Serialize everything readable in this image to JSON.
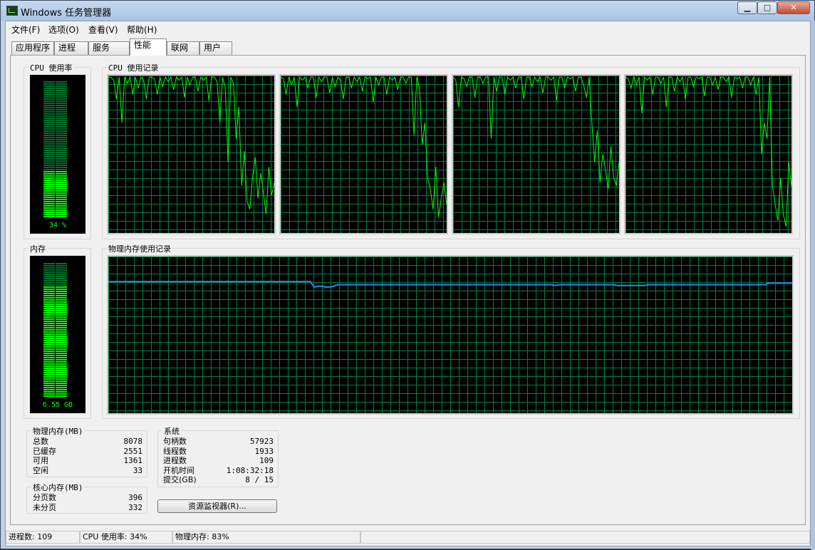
{
  "window": {
    "title": "Windows 任务管理器",
    "controls": {
      "minimize": "▁",
      "maximize": "□",
      "close": "✕"
    }
  },
  "menu": [
    {
      "label": "文件(F)"
    },
    {
      "label": "选项(O)"
    },
    {
      "label": "查看(V)"
    },
    {
      "label": "帮助(H)"
    }
  ],
  "tabs": [
    {
      "label": "应用程序",
      "active": false
    },
    {
      "label": "进程",
      "active": false
    },
    {
      "label": "服务",
      "active": false
    },
    {
      "label": "性能",
      "active": true
    },
    {
      "label": "联网",
      "active": false
    },
    {
      "label": "用户",
      "active": false
    }
  ],
  "performance": {
    "cpu_usage": {
      "title": "CPU 使用率",
      "value_text": "34 %",
      "percent": 34
    },
    "cpu_history": {
      "title": "CPU 使用记录",
      "cores": [
        [
          99,
          99,
          97,
          85,
          99,
          70,
          99,
          95,
          99,
          88,
          99,
          92,
          99,
          97,
          85,
          99,
          99,
          98,
          88,
          99,
          93,
          99,
          96,
          99,
          91,
          99,
          97,
          99,
          86,
          99,
          94,
          99,
          99,
          90,
          99,
          97,
          99,
          84,
          99,
          99,
          96,
          70,
          99,
          92,
          45,
          99,
          95,
          60,
          80,
          30,
          52,
          20,
          15,
          35,
          48,
          22,
          38,
          26,
          12,
          42,
          24,
          32
        ],
        [
          99,
          98,
          88,
          99,
          94,
          99,
          80,
          99,
          97,
          99,
          92,
          99,
          99,
          86,
          99,
          96,
          99,
          99,
          89,
          99,
          93,
          99,
          97,
          85,
          99,
          99,
          92,
          99,
          96,
          99,
          90,
          99,
          98,
          99,
          83,
          99,
          94,
          99,
          99,
          88,
          99,
          97,
          99,
          91,
          99,
          99,
          95,
          99,
          99,
          62,
          99,
          92,
          56,
          70,
          35,
          28,
          15,
          42,
          10,
          22,
          32,
          18
        ],
        [
          99,
          97,
          80,
          99,
          98,
          93,
          99,
          99,
          86,
          99,
          99,
          95,
          99,
          99,
          60,
          99,
          90,
          99,
          99,
          88,
          99,
          97,
          99,
          92,
          99,
          99,
          85,
          99,
          99,
          93,
          99,
          96,
          99,
          89,
          99,
          99,
          97,
          99,
          84,
          99,
          99,
          92,
          99,
          98,
          99,
          90,
          99,
          99,
          94,
          86,
          99,
          70,
          45,
          65,
          32,
          50,
          40,
          28,
          55,
          35,
          30,
          45
        ],
        [
          99,
          98,
          92,
          99,
          94,
          99,
          76,
          99,
          97,
          99,
          88,
          99,
          99,
          95,
          99,
          80,
          99,
          99,
          90,
          99,
          96,
          99,
          85,
          99,
          99,
          93,
          99,
          98,
          99,
          87,
          99,
          99,
          94,
          99,
          91,
          99,
          99,
          96,
          99,
          86,
          99,
          98,
          99,
          92,
          99,
          99,
          94,
          99,
          88,
          99,
          50,
          70,
          60,
          99,
          30,
          18,
          8,
          35,
          12,
          4,
          45,
          30
        ]
      ]
    },
    "memory": {
      "title": "内存",
      "value_text": "6.55 GB",
      "percent": 83
    },
    "memory_history": {
      "title": "物理内存使用记录",
      "series": [
        84,
        84,
        84,
        84,
        84,
        84,
        84,
        84,
        84,
        84,
        84,
        84,
        84,
        84,
        84,
        84,
        84,
        84,
        84,
        84,
        84,
        84,
        84,
        84,
        84,
        84,
        84,
        84,
        84,
        84,
        84,
        84,
        84,
        84,
        84,
        84,
        84,
        84,
        84,
        84,
        84,
        84,
        84,
        84,
        84,
        84,
        84,
        84,
        84,
        84,
        84,
        84,
        84,
        80.5,
        81,
        81,
        80.5,
        80.5,
        81,
        82,
        82,
        82,
        82,
        82,
        82,
        82,
        82,
        82,
        82,
        82,
        82,
        82,
        82,
        82,
        82,
        82,
        82,
        82,
        82,
        82,
        82,
        82,
        82,
        82,
        82,
        82,
        82,
        82,
        82,
        82,
        82,
        82,
        82,
        82,
        82,
        82,
        82,
        82,
        82,
        82,
        82,
        82,
        82,
        82,
        82,
        82,
        82,
        82,
        82,
        82,
        82,
        82,
        82,
        82,
        82,
        81.5,
        82,
        82,
        82,
        82,
        82,
        82,
        82,
        82,
        82,
        82,
        82,
        82,
        82,
        82,
        82,
        81.5,
        81.5,
        81.5,
        81.5,
        81.5,
        81.5,
        81.5,
        81.5,
        82,
        82,
        82,
        82,
        82,
        82,
        82,
        82,
        82,
        82,
        82,
        82,
        82,
        82,
        82,
        82,
        82,
        82,
        82,
        82,
        82,
        82,
        82,
        82,
        82,
        82,
        82,
        82,
        82,
        82,
        82,
        83,
        83,
        83,
        83,
        83,
        83,
        83
      ]
    },
    "physical_memory": {
      "title": "物理内存(MB)",
      "rows": [
        {
          "label": "总数",
          "value": "8078"
        },
        {
          "label": "已缓存",
          "value": "2551"
        },
        {
          "label": "可用",
          "value": "1361"
        },
        {
          "label": "空闲",
          "value": "33"
        }
      ]
    },
    "kernel_memory": {
      "title": "核心内存(MB)",
      "rows": [
        {
          "label": "分页数",
          "value": "396"
        },
        {
          "label": "未分页",
          "value": "332"
        }
      ]
    },
    "system": {
      "title": "系统",
      "rows": [
        {
          "label": "句柄数",
          "value": "57923"
        },
        {
          "label": "线程数",
          "value": "1933"
        },
        {
          "label": "进程数",
          "value": "109"
        },
        {
          "label": "开机时间",
          "value": "1:08:32:18"
        },
        {
          "label": "提交(GB)",
          "value": "8 / 15"
        }
      ]
    },
    "resource_monitor_button": "资源监视器(R)..."
  },
  "status": {
    "processes": "进程数: 109",
    "cpu": "CPU 使用率: 34%",
    "memory": "物理内存: 83%"
  },
  "colors": {
    "graph_bg": "#000000",
    "grid": "#008040",
    "cpu_line": "#00ff00",
    "mem_line": "#2a8cf0",
    "meter_on": "#00ff00",
    "meter_off": "#00702a"
  }
}
